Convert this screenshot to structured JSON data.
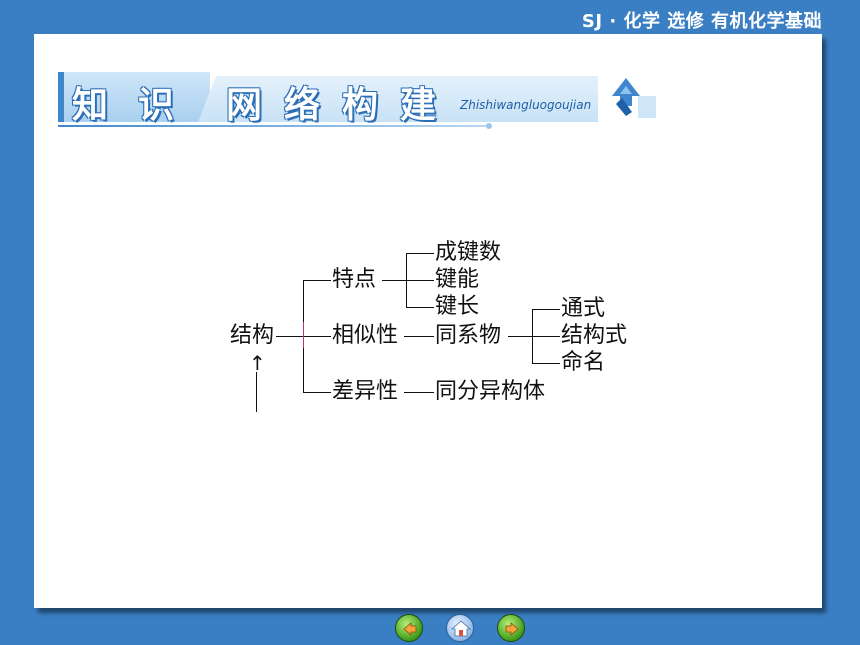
{
  "header": {
    "course_title": "SJ · 化学  选修  有机化学基础"
  },
  "banner": {
    "chars": [
      "知",
      "识",
      "网",
      "络",
      "构",
      "建"
    ],
    "pinyin": "Zhishiwangluogoujian"
  },
  "diagram": {
    "root": "结构",
    "branch_features": "特点",
    "leaf_bond_count": "成键数",
    "leaf_bond_energy": "键能",
    "leaf_bond_length": "键长",
    "branch_similarity": "相似性",
    "node_homolog": "同系物",
    "leaf_general_formula": "通式",
    "leaf_structural_formula": "结构式",
    "leaf_naming": "命名",
    "branch_difference": "差异性",
    "node_isomer": "同分异构体",
    "arrow": "↑"
  },
  "colors": {
    "background": "#3a7fc4",
    "slide": "#ffffff",
    "accent": "#3f86cf",
    "connector_highlight": "#c0307a"
  },
  "icons": {
    "banner_icon": "up-arrow-icon",
    "nav": [
      "back-icon",
      "home-icon",
      "forward-icon"
    ]
  }
}
